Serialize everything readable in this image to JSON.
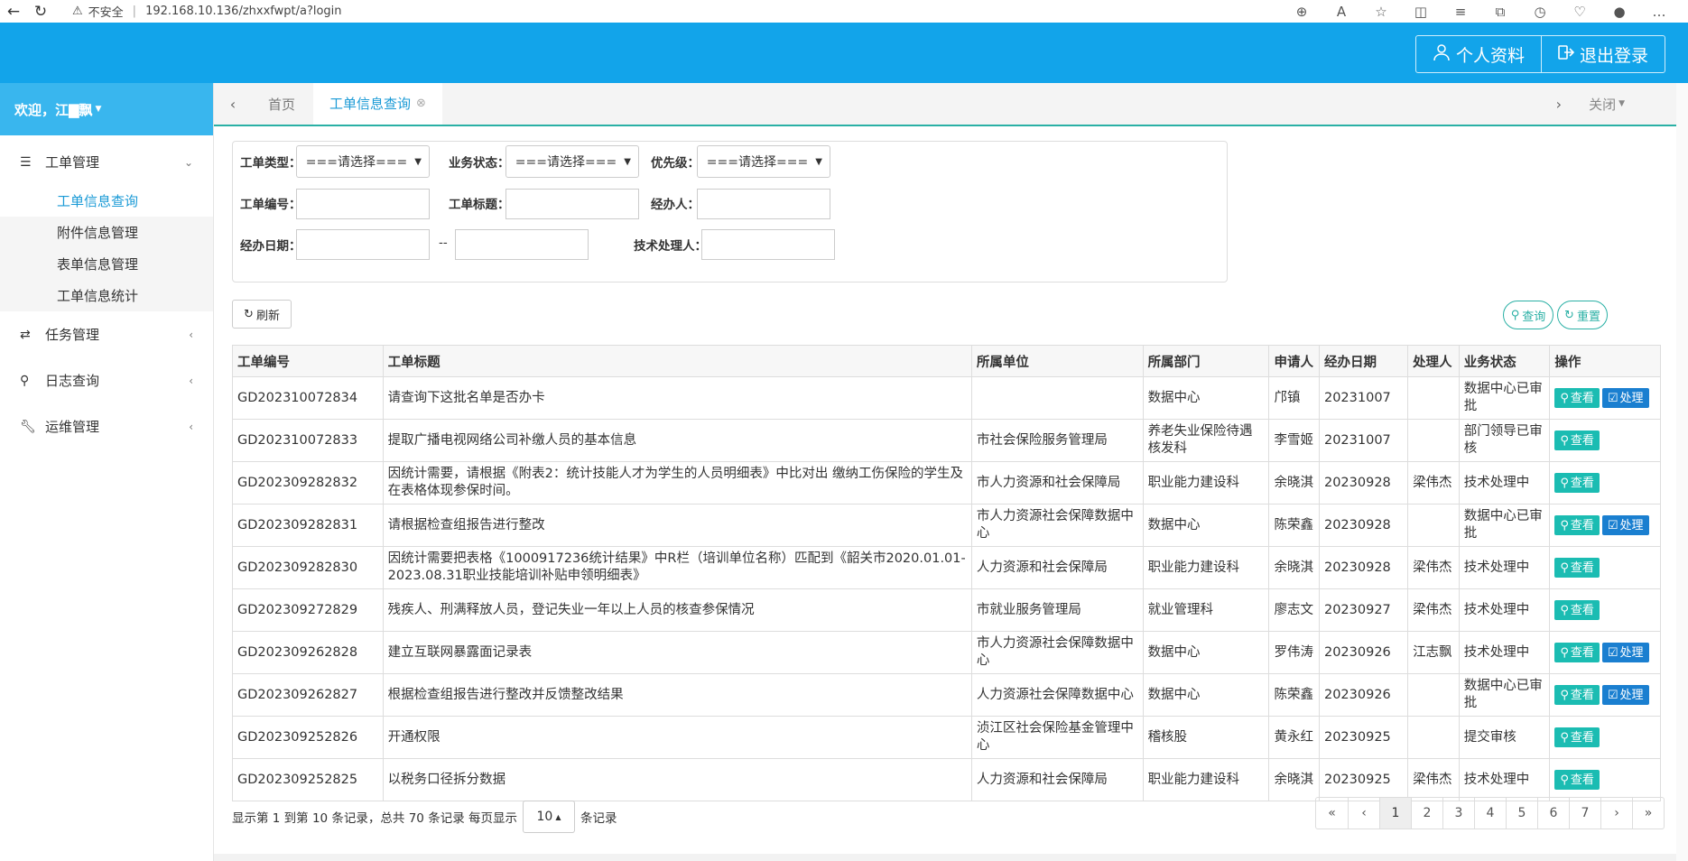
{
  "browser": {
    "security_label": "不安全",
    "url": "192.168.10.136/zhxxfwpt/a?login"
  },
  "header": {
    "profile_label": "个人资料",
    "logout_label": "退出登录"
  },
  "sidebar": {
    "welcome": "欢迎，江▇飘",
    "groups": [
      {
        "label": "工单管理",
        "items": [
          "工单信息查询",
          "附件信息管理",
          "表单信息管理",
          "工单信息统计"
        ]
      },
      {
        "label": "任务管理"
      },
      {
        "label": "日志查询"
      },
      {
        "label": "运维管理"
      }
    ]
  },
  "tabs": {
    "home": "首页",
    "active": "工单信息查询",
    "close_label": "关闭"
  },
  "filters": {
    "type_label": "工单类型：",
    "status_label": "业务状态：",
    "priority_label": "优先级：",
    "select_default": "===请选择===",
    "id_label": "工单编号：",
    "title_label": "工单标题：",
    "handler_label": "经办人：",
    "date_label": "经办日期：",
    "date_sep": "--",
    "tech_label": "技术处理人："
  },
  "toolbar": {
    "refresh": "刷新",
    "query": "查询",
    "reset": "重置"
  },
  "table": {
    "columns": [
      "工单编号",
      "工单标题",
      "所属单位",
      "所属部门",
      "申请人",
      "经办日期",
      "处理人",
      "业务状态",
      "操作"
    ],
    "view_label": "查看",
    "process_label": "处理",
    "rows": [
      {
        "id": "GD202310072834",
        "title": "请查询下这批名单是否办卡",
        "unit": "",
        "dept": "数据中心",
        "applicant": "邝镇",
        "date": "20231007",
        "handler": "",
        "status": "数据中心已审批",
        "process": true
      },
      {
        "id": "GD202310072833",
        "title": "提取广播电视网络公司补缴人员的基本信息",
        "unit": "市社会保险服务管理局",
        "dept": "养老失业保险待遇核发科",
        "applicant": "李雪姬",
        "date": "20231007",
        "handler": "",
        "status": "部门领导已审核",
        "process": false
      },
      {
        "id": "GD202309282832",
        "title": "因统计需要，请根据《附表2：统计技能人才为学生的人员明细表》中比对出 缴纳工伤保险的学生及在表格体现参保时间。",
        "unit": "市人力资源和社会保障局",
        "dept": "职业能力建设科",
        "applicant": "余晓淇",
        "date": "20230928",
        "handler": "梁伟杰",
        "status": "技术处理中",
        "process": false
      },
      {
        "id": "GD202309282831",
        "title": "请根据检查组报告进行整改",
        "unit": "市人力资源社会保障数据中心",
        "dept": "数据中心",
        "applicant": "陈荣鑫",
        "date": "20230928",
        "handler": "",
        "status": "数据中心已审批",
        "process": true
      },
      {
        "id": "GD202309282830",
        "title": "因统计需要把表格《1000917236统计结果》中R栏（培训单位名称）匹配到《韶关市2020.01.01-2023.08.31职业技能培训补贴申领明细表》",
        "unit": "人力资源和社会保障局",
        "dept": "职业能力建设科",
        "applicant": "余晓淇",
        "date": "20230928",
        "handler": "梁伟杰",
        "status": "技术处理中",
        "process": false
      },
      {
        "id": "GD202309272829",
        "title": "残疾人、刑满释放人员，登记失业一年以上人员的核查参保情况",
        "unit": "市就业服务管理局",
        "dept": "就业管理科",
        "applicant": "廖志文",
        "date": "20230927",
        "handler": "梁伟杰",
        "status": "技术处理中",
        "process": false
      },
      {
        "id": "GD202309262828",
        "title": "建立互联网暴露面记录表",
        "unit": "市人力资源社会保障数据中心",
        "dept": "数据中心",
        "applicant": "罗伟涛",
        "date": "20230926",
        "handler": "江志飘",
        "status": "技术处理中",
        "process": true
      },
      {
        "id": "GD202309262827",
        "title": "根据检查组报告进行整改并反馈整改结果",
        "unit": "人力资源社会保障数据中心",
        "dept": "数据中心",
        "applicant": "陈荣鑫",
        "date": "20230926",
        "handler": "",
        "status": "数据中心已审批",
        "process": true
      },
      {
        "id": "GD202309252826",
        "title": "开通权限",
        "unit": "浈江区社会保险基金管理中心",
        "dept": "稽核股",
        "applicant": "黄永红",
        "date": "20230925",
        "handler": "",
        "status": "提交审核",
        "process": false
      },
      {
        "id": "GD202309252825",
        "title": "以税务口径拆分数据",
        "unit": "人力资源和社会保障局",
        "dept": "职业能力建设科",
        "applicant": "余晓淇",
        "date": "20230925",
        "handler": "梁伟杰",
        "status": "技术处理中",
        "process": false
      }
    ]
  },
  "pager": {
    "summary": "显示第 1 到第 10 条记录，总共 70 条记录 每页显示",
    "page_size": "10",
    "suffix": "条记录",
    "pages": [
      "«",
      "‹",
      "1",
      "2",
      "3",
      "4",
      "5",
      "6",
      "7",
      "›",
      "»"
    ],
    "current": "1"
  }
}
